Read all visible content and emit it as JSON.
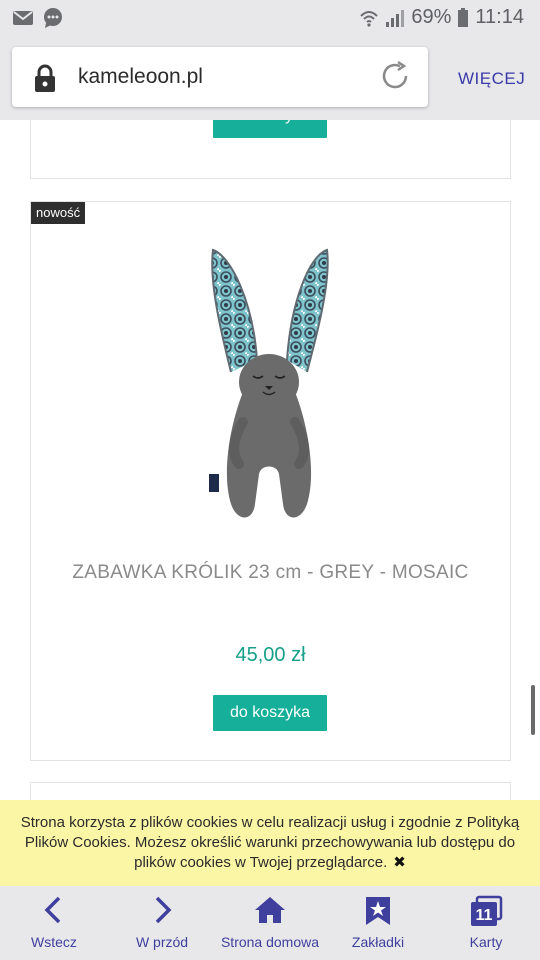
{
  "status_bar": {
    "battery_percent": "69%",
    "time": "11:14",
    "icons": [
      "mail-icon",
      "chat-icon",
      "wifi-icon",
      "signal-icon",
      "battery-icon"
    ]
  },
  "browser": {
    "url": "kameleoon.pl",
    "more_label": "WIĘCEJ"
  },
  "page": {
    "prev_card": {
      "cart_label": "do koszyka"
    },
    "product": {
      "badge": "nowość",
      "title": "ZABAWKA KRÓLIK 23 cm - GREY - MOSAIC",
      "price": "45,00 zł",
      "cart_label": "do koszyka"
    }
  },
  "cookie_banner": {
    "text": "Strona korzysta z plików cookies w celu realizacji usług i zgodnie z Polityką Plików Cookies. Możesz określić warunki przechowywania lub dostępu do plików cookies w Twojej przeglądarce.",
    "close_symbol": "✖"
  },
  "bottom_nav": {
    "back": "Wstecz",
    "forward": "W przód",
    "home": "Strona domowa",
    "bookmarks": "Zakładki",
    "tabs": "Karty",
    "tabs_count": "11"
  },
  "colors": {
    "accent_green": "#16b09a",
    "nav_blue": "#3f3f9e",
    "cookie_yellow": "#fbf6a5"
  }
}
